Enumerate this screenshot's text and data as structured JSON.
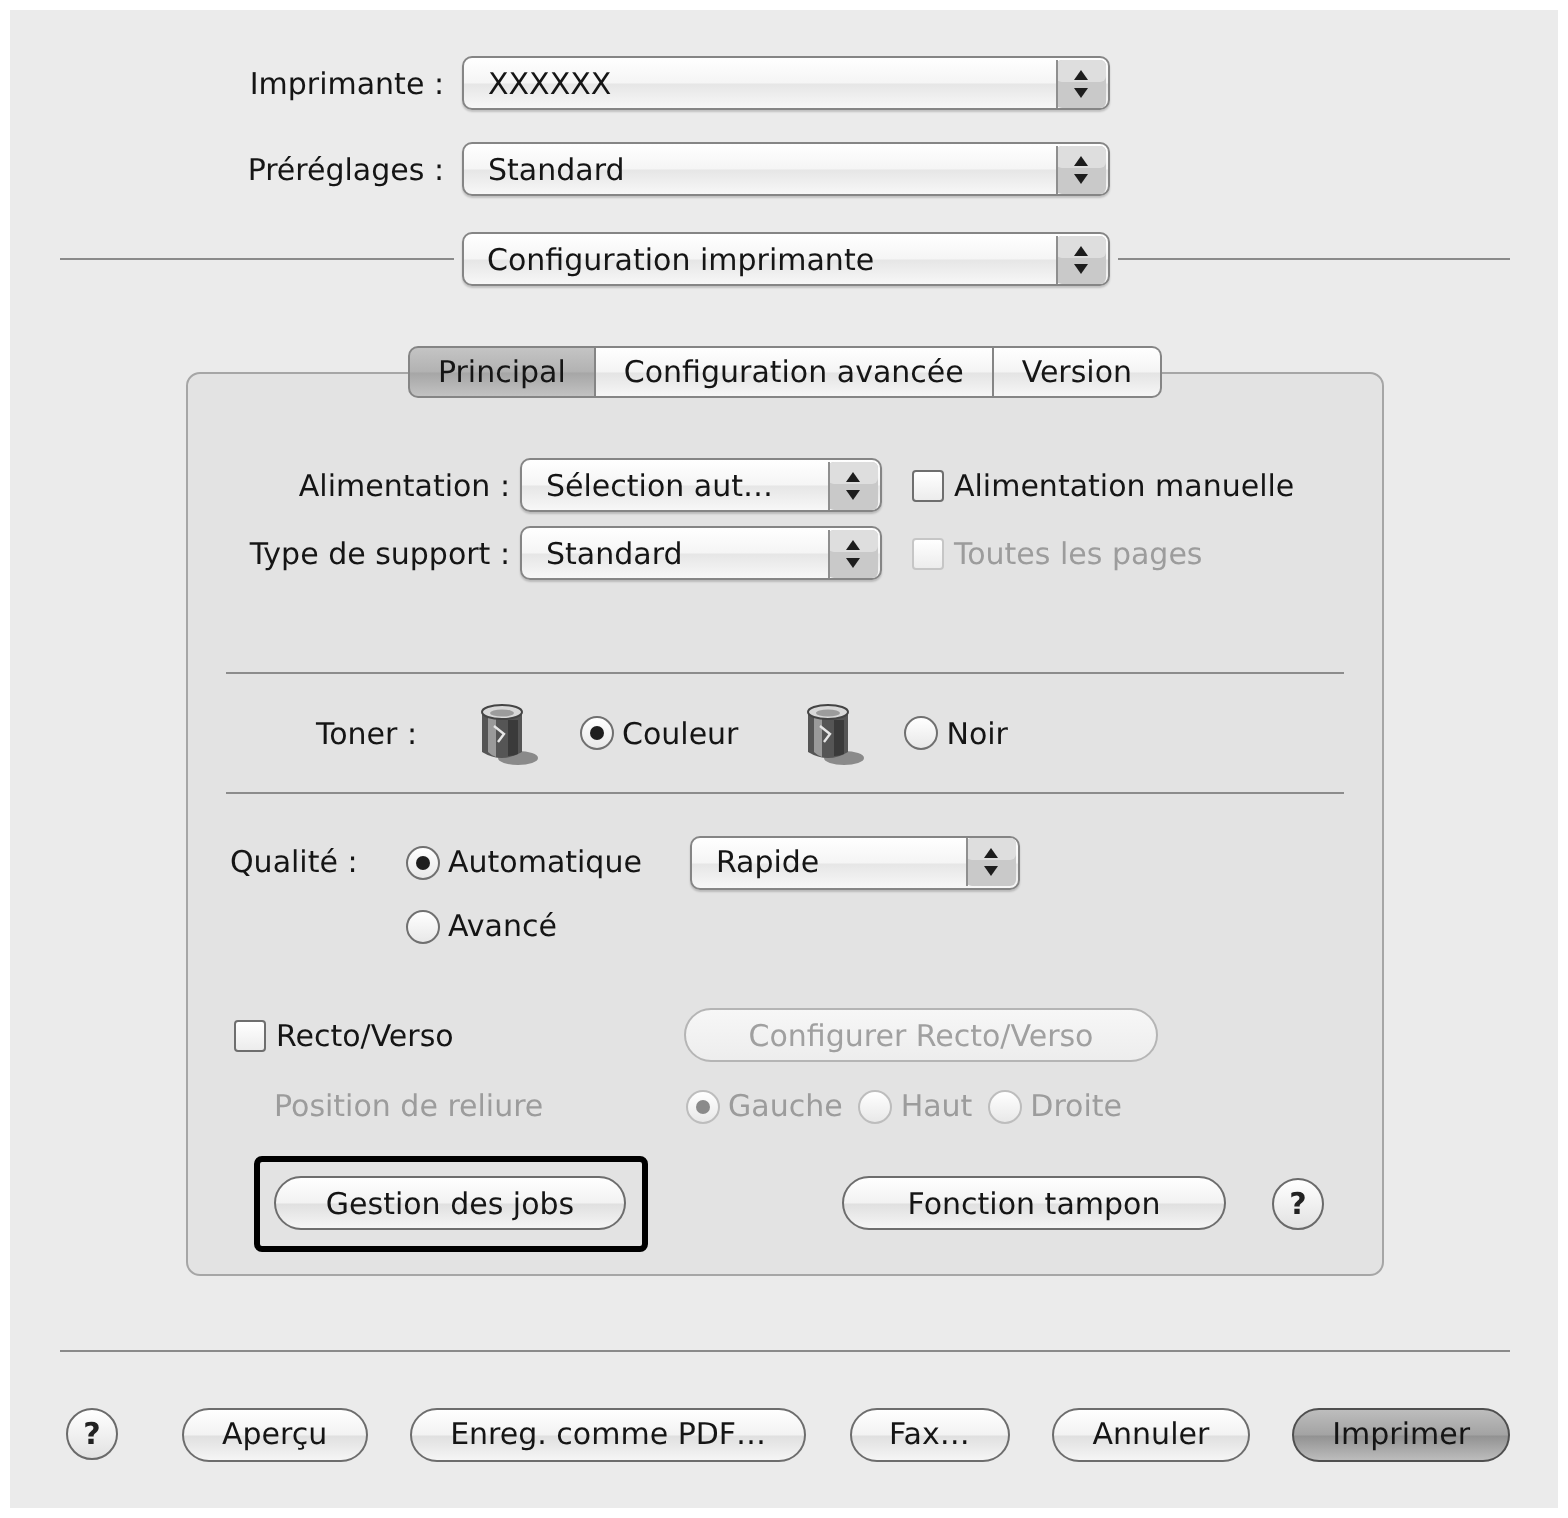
{
  "printer": {
    "label": "Imprimante :",
    "value": "XXXXXX"
  },
  "presets": {
    "label": "Préréglages :",
    "value": "Standard"
  },
  "panel_menu": {
    "value": "Configuration imprimante"
  },
  "tabs": [
    {
      "label": "Principal",
      "selected": true
    },
    {
      "label": "Configuration avancée",
      "selected": false
    },
    {
      "label": "Version",
      "selected": false
    }
  ],
  "paper": [
    {
      "label": "Alimentation :",
      "value": "Sélection aut…",
      "option": {
        "label": "Alimentation manuelle",
        "checked": false,
        "disabled": false
      }
    },
    {
      "label": "Type de support :",
      "value": "Standard",
      "option": {
        "label": "Toutes les pages",
        "checked": false,
        "disabled": true
      }
    }
  ],
  "toner": {
    "label": "Toner :",
    "options": [
      {
        "label": "Couleur",
        "selected": true
      },
      {
        "label": "Noir",
        "selected": false
      }
    ]
  },
  "quality": {
    "label": "Qualité :",
    "options": [
      {
        "label": "Automatique",
        "selected": true
      },
      {
        "label": "Avancé",
        "selected": false
      }
    ],
    "preset": {
      "value": "Rapide"
    }
  },
  "duplex": {
    "label": "Recto/Verso",
    "checked": false,
    "configure_button": {
      "label": "Configurer Recto/Verso",
      "disabled": true
    },
    "binding": {
      "label": "Position de reliure",
      "disabled": true,
      "options": [
        {
          "label": "Gauche",
          "selected": true
        },
        {
          "label": "Haut",
          "selected": false
        },
        {
          "label": "Droite",
          "selected": false
        }
      ]
    }
  },
  "panel_buttons": [
    {
      "label": "Gestion des jobs",
      "highlighted": true
    },
    {
      "label": "Fonction tampon",
      "highlighted": false
    }
  ],
  "panel_help": {
    "label": "?"
  },
  "footer": {
    "help": {
      "label": "?"
    },
    "buttons": [
      {
        "label": "Aperçu",
        "default": false
      },
      {
        "label": "Enreg. comme PDF…",
        "default": false
      },
      {
        "label": "Fax…",
        "default": false
      },
      {
        "label": "Annuler",
        "default": false
      },
      {
        "label": "Imprimer",
        "default": true
      }
    ]
  }
}
